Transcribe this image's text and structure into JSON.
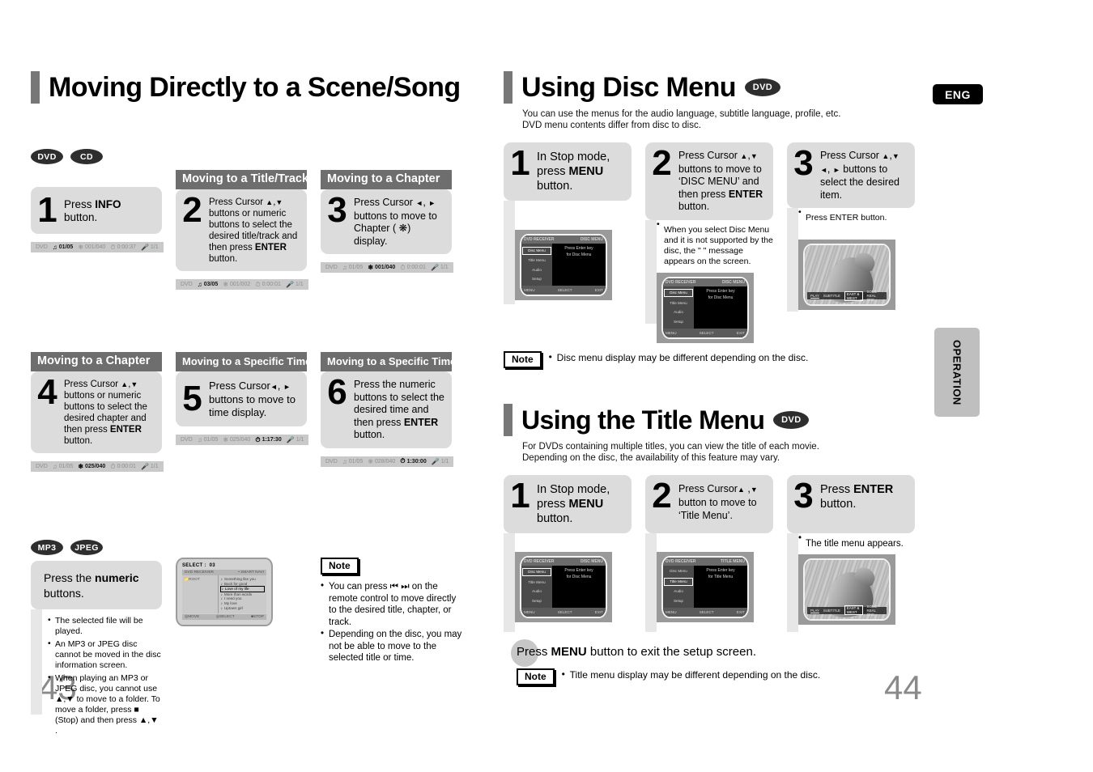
{
  "page": {
    "lang_badge": "ENG",
    "side_tab": "OPERATION",
    "number_left": "43",
    "number_right": "44"
  },
  "left_section": {
    "title": "Moving Directly to a Scene/Song",
    "disc_pills": [
      "DVD",
      "CD"
    ],
    "steps_row1": [
      {
        "header": "",
        "num": "1",
        "text": "Press INFO button.",
        "text_bold": "INFO",
        "osd": {
          "label": "DVD",
          "title": "01/05",
          "chapter": "001/040",
          "time": "0:00:37",
          "audio": "1/1",
          "highlight": "title"
        }
      },
      {
        "header": "Moving to a Title/Track",
        "num": "2",
        "text": "Press Cursor ▲,▼ buttons or numeric buttons to select the desired title/track and then press ENTER button.",
        "osd": {
          "label": "DVD",
          "title": "03/05",
          "chapter": "001/002",
          "time": "0:00:01",
          "audio": "1/1",
          "highlight": "title"
        }
      },
      {
        "header": "Moving to a Chapter",
        "num": "3",
        "text": "Press Cursor ◄, ► buttons to move to Chapter ( ✿ ) display.",
        "osd": {
          "label": "DVD",
          "title": "01/05",
          "chapter": "001/040",
          "time": "0:00:01",
          "audio": "1/1",
          "highlight": "chapter"
        }
      }
    ],
    "steps_row2": [
      {
        "header": "Moving to a Chapter",
        "num": "4",
        "text": "Press Cursor ▲,▼ buttons or numeric buttons to select the desired chapter and then press ENTER button.",
        "osd": {
          "label": "DVD",
          "title": "01/05",
          "chapter": "025/040",
          "time": "0:00:01",
          "audio": "1/1",
          "highlight": "chapter"
        }
      },
      {
        "header": "Moving to a Specific Time",
        "num": "5",
        "text": "Press Cursor◄, ► buttons to move to time display.",
        "osd": {
          "label": "DVD",
          "title": "01/05",
          "chapter": "025/040",
          "time": "1:17:30",
          "audio": "1/1",
          "highlight": "time"
        }
      },
      {
        "header": "Moving to a Specific Time",
        "num": "6",
        "text": "Press the numeric buttons to select the desired time and then press ENTER button.",
        "osd": {
          "label": "DVD",
          "title": "01/05",
          "chapter": "028/040",
          "time": "1:30:00",
          "audio": "1/1",
          "highlight": "time"
        }
      }
    ],
    "mp3_pills": [
      "MP3",
      "JPEG"
    ],
    "mp3_step": {
      "text_pre": "Press the ",
      "text_bold": "numeric",
      "text_post": " buttons."
    },
    "mp3_bullets": [
      "The selected file will be played.",
      "An MP3 or JPEG disc cannot be moved in the disc information screen.",
      "When playing an MP3 or JPEG disc, you cannot use ▲,▼ to move to a folder. To move a folder, press ■ (Stop) and then press ▲,▼ ."
    ],
    "mp3_screen": {
      "select_label": "SELECT :",
      "select_value": "03",
      "header_left": "DVD RECEIVER",
      "header_right": "• SMART NAVI",
      "tree_root": "ROOT",
      "files": [
        "Something like you",
        "Back for good",
        "Love of my life",
        "More than words",
        "I need you",
        "My love",
        "Uptown girl"
      ],
      "selected_index": 2,
      "footer": [
        "MOVE",
        "SELECT",
        "STOP"
      ]
    },
    "note": {
      "label": "Note",
      "items": [
        "You can press ⏮ ⏭ on the remote control to move directly to the desired title, chapter, or track.",
        "Depending on the disc, you may not be able to move to the selected title or time."
      ]
    }
  },
  "right_sections": [
    {
      "title": "Using Disc Menu",
      "badge": "DVD",
      "desc": "You can use the menus for the audio language, subtitle language, profile, etc. DVD menu contents differ from disc to disc.",
      "steps": [
        {
          "num": "1",
          "text": "In Stop mode, press MENU button.",
          "bullets": [],
          "screen": "osd-disc-menu"
        },
        {
          "num": "2",
          "text": "Press Cursor ▲,▼ buttons to move to ‘DISC MENU’ and then press ENTER button.",
          "bullets": [
            "When you select Disc Menu and it is not supported by the disc, the \" \" message appears on the screen."
          ],
          "screen": "osd-disc-menu"
        },
        {
          "num": "3",
          "text": "Press Cursor ▲,▼ ◄, ► buttons to select the desired item.",
          "bullets": [
            "Press ENTER button."
          ],
          "screen": "photo-dolphin"
        }
      ],
      "note": {
        "label": "Note",
        "text": "Disc menu display may be different depending on the disc."
      }
    },
    {
      "title": "Using the Title Menu",
      "badge": "DVD",
      "desc": "For DVDs containing multiple titles, you can view the title of each movie. Depending on the disc, the availability of this feature may vary.",
      "steps": [
        {
          "num": "1",
          "text": "In Stop mode, press MENU button.",
          "bullets": [],
          "screen": "osd-disc-menu"
        },
        {
          "num": "2",
          "text": "Press Cursor ▲,▼ button to move to ‘Title Menu’.",
          "bullets": [],
          "screen": "osd-title-menu"
        },
        {
          "num": "3",
          "text": "Press ENTER button.",
          "bullets": [
            "The title menu appears."
          ],
          "screen": "photo-dolphin"
        }
      ],
      "exit_line": "Press MENU button to exit the setup screen.",
      "note": {
        "label": "Note",
        "text": "Title menu display may be different depending on the disc."
      }
    }
  ],
  "osd_menu_screens": {
    "disc_menu": {
      "header_left": "DVD RECEIVER",
      "header_right": "DISC MENU",
      "items": [
        "Disc Menu",
        "Title Menu",
        "Audio",
        "Setup"
      ],
      "selected": "Disc Menu",
      "center_line1": "Press Enter key",
      "center_line2": "for Disc Menu",
      "footer": [
        "MENU",
        "SELECT",
        "EXIT"
      ]
    },
    "title_menu": {
      "header_left": "DVD RECEIVER",
      "header_right": "TITLE MENU",
      "items": [
        "Disc Menu",
        "Title Menu",
        "Audio",
        "Setup"
      ],
      "selected": "Title Menu",
      "center_line1": "Press Enter key",
      "center_line2": "for Title Menu",
      "footer": [
        "MENU",
        "SELECT",
        "EXIT"
      ]
    },
    "photo_bar": [
      "PLAY",
      "SUBTITLE",
      "EAST & WEST",
      "SOME REAL ONE"
    ]
  }
}
